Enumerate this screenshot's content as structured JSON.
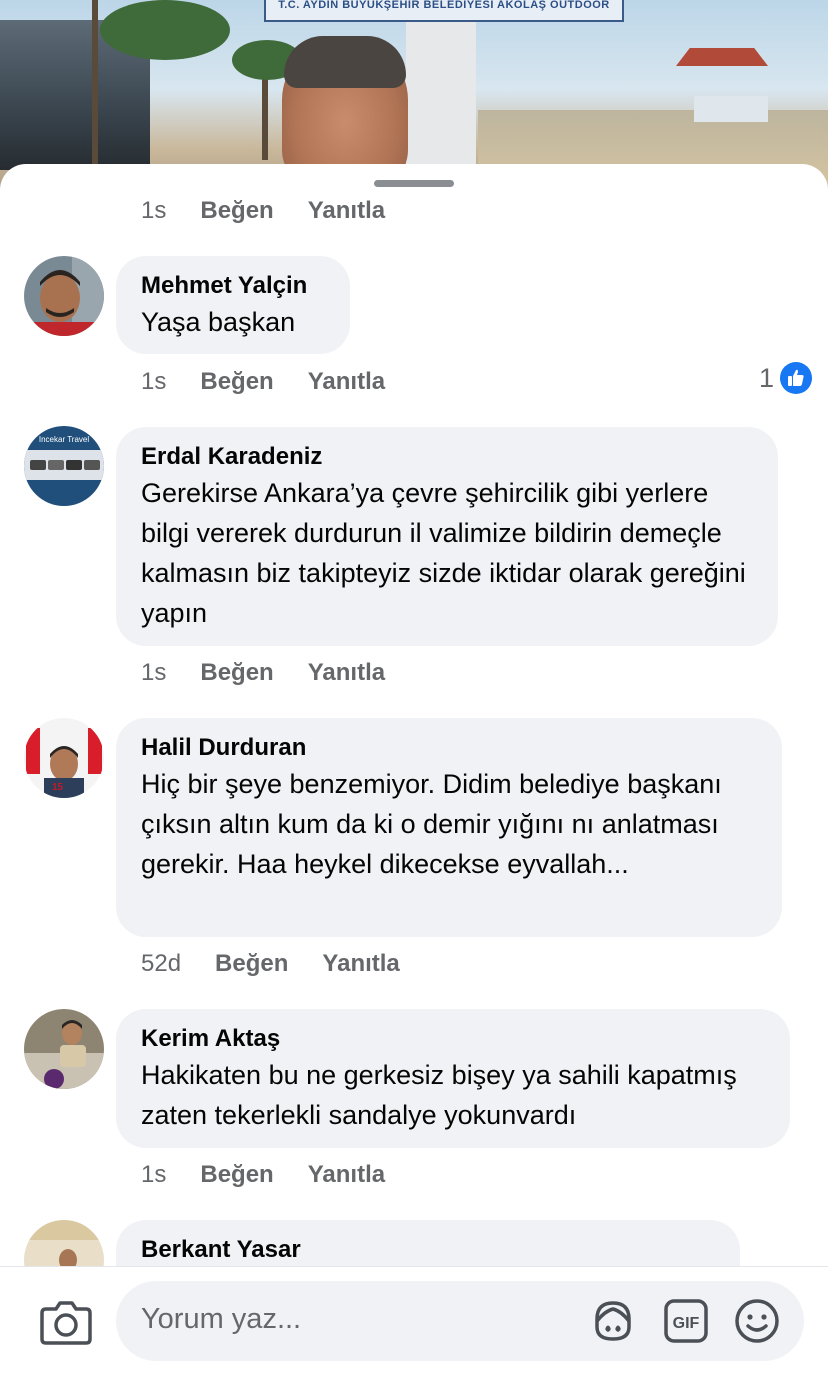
{
  "background": {
    "sign_text": "T.C. AYDIN BÜYÜKŞEHİR BELEDİYESİ   AKOLAŞ OUTDOOR"
  },
  "comments": [
    {
      "name": "",
      "text": "",
      "time": "1s",
      "like_label": "Beğen",
      "reply_label": "Yanıtla"
    },
    {
      "name": "Mehmet Yalçin",
      "text": "Yaşa başkan",
      "time": "1s",
      "like_label": "Beğen",
      "reply_label": "Yanıtla",
      "reaction_count": "1"
    },
    {
      "name": "Erdal Karadeniz",
      "text": "Gerekirse Ankara’ya çevre şehircilik gibi yerlere bilgi vererek durdurun il valimize bildirin demeçle kalmasın biz takipteyiz sizde iktidar olarak gereğini yapın",
      "time": "1s",
      "like_label": "Beğen",
      "reply_label": "Yanıtla",
      "avatar_text": "Incekar Travel"
    },
    {
      "name": "Halil Durduran",
      "text": "Hiç bir şeye benzemiyor. Didim belediye başkanı çıksın altın kum da ki o demir yığını nı anlatması gerekir. Haa heykel dikecekse eyvallah...",
      "time": "52d",
      "like_label": "Beğen",
      "reply_label": "Yanıtla"
    },
    {
      "name": "Kerim Aktaş",
      "text": "Hakikaten bu ne gerkesiz bişey ya sahili kapatmış zaten tekerlekli sandalye yokunvardı",
      "time": "1s",
      "like_label": "Beğen",
      "reply_label": "Yanıtla"
    },
    {
      "name": "Berkant Yasar",
      "text": ""
    }
  ],
  "composer": {
    "placeholder": "Yorum yaz...",
    "camera_icon": "camera-icon",
    "avatar_sticker_icon": "avatar-sticker-icon",
    "gif_label": "GIF",
    "emoji_icon": "emoji-icon"
  },
  "colors": {
    "bubble": "#f0f2f5",
    "meta_text": "#65676b",
    "like_blue": "#1877f2",
    "text": "#050505"
  }
}
